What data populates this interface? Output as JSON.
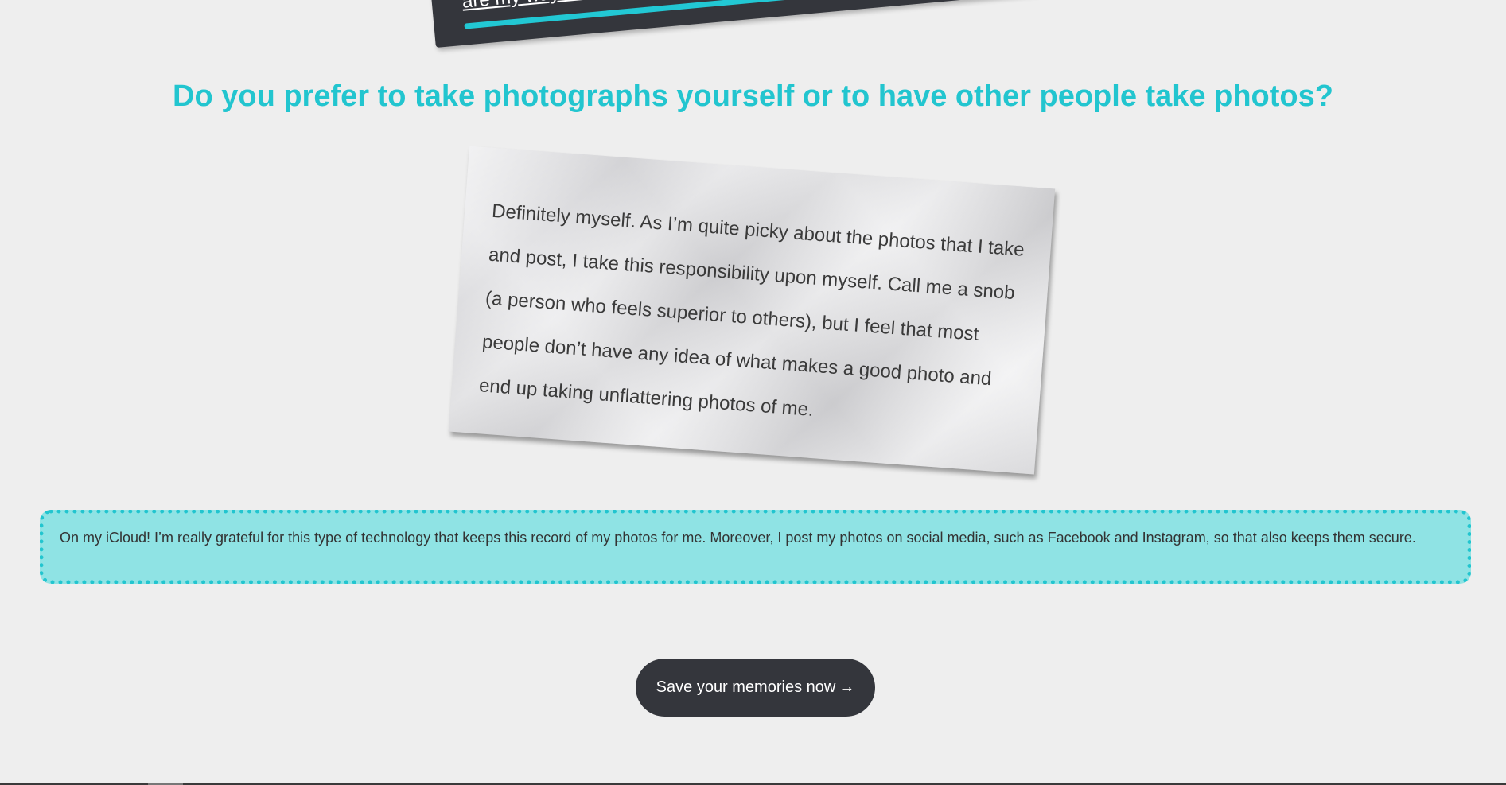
{
  "top_card": {
    "text": "are my way of sharing"
  },
  "question": {
    "title": "Do you prefer to take photographs yourself or to have other people take photos?"
  },
  "answer_card": {
    "text": "Definitely myself. As I’m quite picky about the photos that I take and post, I take this responsibility upon myself. Call me a snob (a person who feels superior to others), but I feel that most people don’t have any idea of what makes a good photo and end up taking unflattering photos of me."
  },
  "info_box": {
    "text": "On my iCloud! I’m really grateful for this type of technology that keeps this record of my photos for me. Moreover, I post my photos on social media, such as Facebook and Instagram, so that also keeps them secure."
  },
  "cta": {
    "label": "Save your memories now",
    "arrow": "→"
  },
  "colors": {
    "background": "#eeeeee",
    "accent": "#22c5cf",
    "dark": "#34363c",
    "info_fill": "#8fe3e4"
  }
}
